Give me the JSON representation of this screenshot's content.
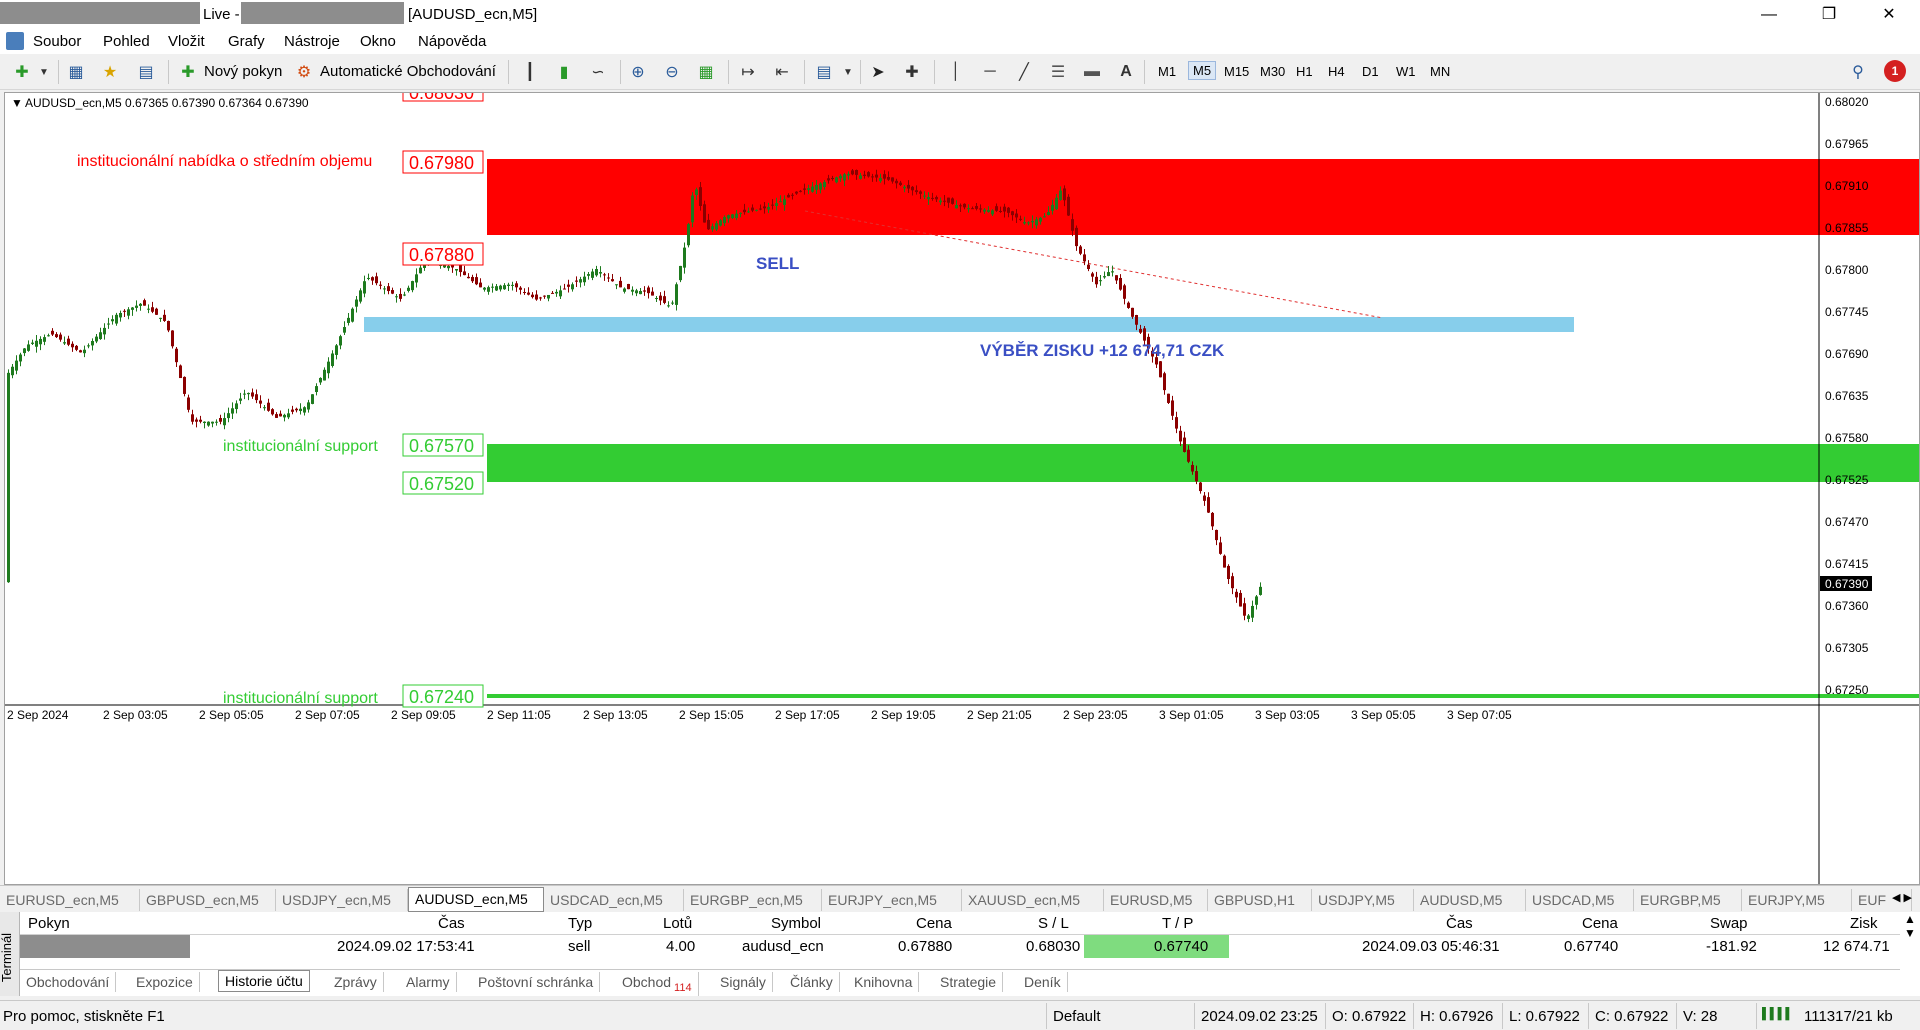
{
  "window": {
    "title_live": "Live -",
    "title_chart": "[AUDUSD_ecn,M5]",
    "min_icon": "minimize-icon",
    "max_icon": "restore-icon",
    "close_icon": "close-icon"
  },
  "menu": [
    "Soubor",
    "Pohled",
    "Vložit",
    "Grafy",
    "Nástroje",
    "Okno",
    "Nápověda"
  ],
  "toolbar": {
    "new_order": "Nový pokyn",
    "auto_trading": "Automatické Obchodování",
    "text_tool": "A",
    "timeframes": [
      "M1",
      "M5",
      "M15",
      "M30",
      "H1",
      "H4",
      "D1",
      "W1",
      "MN"
    ],
    "active_timeframe": "M5",
    "notification_count": "1"
  },
  "chart": {
    "header": "AUDUSD_ecn,M5  0.67365 0.67390 0.67364 0.67390",
    "price_axis": [
      "0.68020",
      "0.67965",
      "0.67910",
      "0.67855",
      "0.67800",
      "0.67745",
      "0.67690",
      "0.67635",
      "0.67580",
      "0.67525",
      "0.67470",
      "0.67415",
      "0.67360",
      "0.67305",
      "0.67250"
    ],
    "current_price": "0.67390",
    "time_axis": [
      "2 Sep 2024",
      "2 Sep 03:05",
      "2 Sep 05:05",
      "2 Sep 07:05",
      "2 Sep 09:05",
      "2 Sep 11:05",
      "2 Sep 13:05",
      "2 Sep 15:05",
      "2 Sep 17:05",
      "2 Sep 19:05",
      "2 Sep 21:05",
      "2 Sep 23:05",
      "3 Sep 01:05",
      "3 Sep 03:05",
      "3 Sep 05:05",
      "3 Sep 07:05"
    ],
    "annotations": {
      "top_partial": "0.68030",
      "supply_label": "institucionální nabídka o středním objemu",
      "supply_top": "0.67980",
      "supply_bottom": "0.67880",
      "sell": "SELL",
      "profit": "VÝBĚR ZISKU +12 674,71 CZK",
      "support_label_1": "institucionální support",
      "support_top": "0.67570",
      "support_bottom": "0.67520",
      "support_label_2": "institucionální support",
      "support_low": "0.67240"
    },
    "colors": {
      "supply": "#ff0000",
      "support": "#33cc33",
      "takeprofit": "#87ceeb",
      "candle_up": "#1e7a1e",
      "candle_down": "#8b0000"
    }
  },
  "symbol_tabs": [
    "EURUSD_ecn,M5",
    "GBPUSD_ecn,M5",
    "USDJPY_ecn,M5",
    "AUDUSD_ecn,M5",
    "USDCAD_ecn,M5",
    "EURGBP_ecn,M5",
    "EURJPY_ecn,M5",
    "XAUUSD_ecn,M5",
    "EURUSD,M5",
    "GBPUSD,H1",
    "USDJPY,M5",
    "AUDUSD,M5",
    "USDCAD,M5",
    "EURGBP,M5",
    "EURJPY,M5",
    "EUF"
  ],
  "active_symbol_tab": "AUDUSD_ecn,M5",
  "terminal": {
    "side_label": "Terminál",
    "columns": [
      "Pokyn",
      "Čas",
      "Typ",
      "Lotů",
      "Symbol",
      "Cena",
      "S / L",
      "T / P",
      "Čas",
      "Cena",
      "Swap",
      "Zisk"
    ],
    "row": {
      "open_time": "2024.09.02 17:53:41",
      "type": "sell",
      "lots": "4.00",
      "symbol": "audusd_ecn",
      "price": "0.67880",
      "sl": "0.68030",
      "tp": "0.67740",
      "close_time": "2024.09.03 05:46:31",
      "close_price": "0.67740",
      "swap": "-181.92",
      "profit": "12 674.71"
    },
    "tabs": [
      "Obchodování",
      "Expozice",
      "Historie účtu",
      "Zprávy",
      "Alarmy",
      "Poštovní schránka",
      "Obchod",
      "Signály",
      "Články",
      "Knihovna",
      "Strategie",
      "Deník"
    ],
    "active_tab": "Historie účtu",
    "obchod_badge": "114"
  },
  "status": {
    "help": "Pro pomoc, stiskněte F1",
    "profile": "Default",
    "datetime": "2024.09.02 23:25",
    "open": "O: 0.67922",
    "high": "H: 0.67926",
    "low": "L: 0.67922",
    "close": "C: 0.67922",
    "volume": "V: 28",
    "traffic": "111317/21 kb"
  }
}
